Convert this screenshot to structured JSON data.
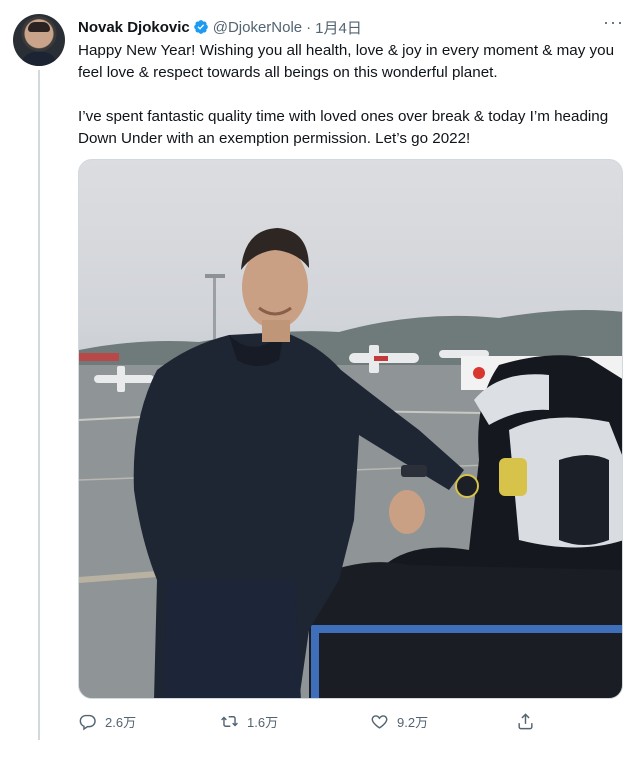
{
  "tweet": {
    "author_name": "Novak Djokovic",
    "handle": "@DjokerNole",
    "separator": "·",
    "date": "1月4日",
    "more_label": "···",
    "paragraphs": [
      "Happy New Year! Wishing you all health, love & joy in every moment & may you feel love & respect towards all beings on this wonderful planet.",
      "I’ve spent fantastic quality time with loved ones over break & today I’m heading Down Under with an exemption permission. Let’s go 2022!"
    ]
  },
  "actions": {
    "reply_count": "2.6万",
    "retweet_count": "1.6万",
    "like_count": "9.2万"
  },
  "colors": {
    "verified": "#1d9bf0",
    "secondary_text": "#536471"
  },
  "icons": {
    "verified": "verified-badge-icon",
    "reply": "reply-icon",
    "retweet": "retweet-icon",
    "like": "heart-icon",
    "share": "share-icon"
  }
}
